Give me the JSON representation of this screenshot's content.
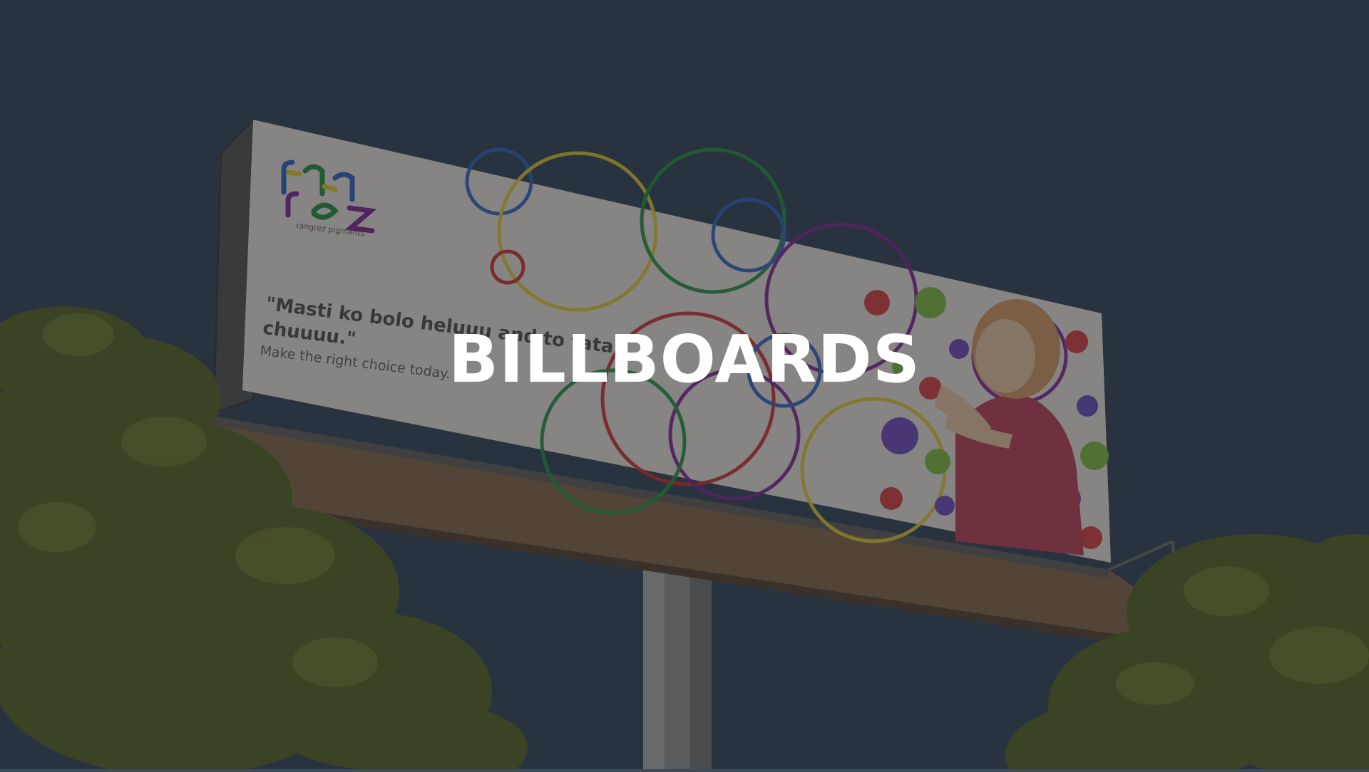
{
  "page": {
    "title": "BILLBOARDS"
  },
  "billboard": {
    "brand_caption": "rangrez pigments",
    "headline": "\"Masti ko bolo heluuu and to tata chuuuu.\"",
    "subline": "Make the right choice today."
  },
  "colors": {
    "sky": "#3d4a5c",
    "overlay": "rgba(18,22,30,0.48)",
    "billboard_face": "#efeae0",
    "foliage": "#5d6a2c",
    "title_text": "#ffffff"
  }
}
